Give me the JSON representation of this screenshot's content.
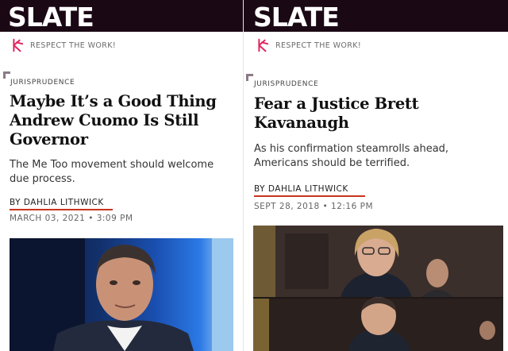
{
  "left": {
    "brand": "SLATE",
    "tagline": "RESPECT THE WORK!",
    "kicker": "JURISPRUDENCE",
    "headline": "Maybe It’s a Good Thing Andrew Cuomo Is Still Governor",
    "dek": "The Me Too movement should welcome due process.",
    "byline": "BY DAHLIA LITHWICK",
    "date": "MARCH 03, 2021",
    "time": "3:09 PM"
  },
  "right": {
    "brand": "SLATE",
    "tagline": "RESPECT THE WORK!",
    "kicker": "JURISPRUDENCE",
    "headline": "Fear a Justice Brett Kavanaugh",
    "dek": "As his confirmation steamrolls ahead, Americans should be terrified.",
    "byline": "BY DAHLIA LITHWICK",
    "date": "SEPT 28, 2018",
    "time": "12:16 PM"
  },
  "colors": {
    "header_bg": "#1b0815",
    "accent_red": "#c8341f",
    "logo_icon": "#e0245e"
  },
  "icons": [
    "slate-k-icon"
  ]
}
